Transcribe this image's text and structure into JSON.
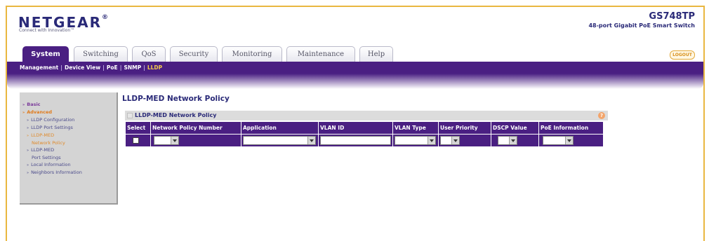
{
  "header": {
    "brand": "NETGEAR",
    "brand_mark": "®",
    "tagline": "Connect with Innovation™",
    "model": "GS748TP",
    "model_desc": "48-port Gigabit PoE Smart Switch"
  },
  "tabs": [
    {
      "label": "System",
      "active": true
    },
    {
      "label": "Switching",
      "active": false
    },
    {
      "label": "QoS",
      "active": false
    },
    {
      "label": "Security",
      "active": false
    },
    {
      "label": "Monitoring",
      "active": false
    },
    {
      "label": "Maintenance",
      "active": false
    },
    {
      "label": "Help",
      "active": false
    }
  ],
  "logout_label": "LOGOUT",
  "subnav": {
    "items": [
      "Management",
      "Device View",
      "PoE",
      "SNMP",
      "LLDP"
    ],
    "separator": "|",
    "current": "LLDP"
  },
  "leftnav": {
    "basic": "Basic",
    "advanced": "Advanced",
    "items": [
      "LLDP Configuration",
      "LLDP Port Settings",
      "LLDP-MED",
      "Network Policy",
      "LLDP-MED",
      "Port Settings",
      "Local Information",
      "Neighbors Information"
    ],
    "arrow": "»",
    "top_arrow": "»"
  },
  "page_title": "LLDP-MED Network Policy",
  "panel": {
    "title": "LLDP-MED Network Policy",
    "help": "?"
  },
  "table": {
    "columns": [
      "Select",
      "Network Policy Number",
      "Application",
      "VLAN ID",
      "VLAN Type",
      "User Priority",
      "DSCP Value",
      "PoE Information"
    ]
  },
  "colors": {
    "brand_purple": "#4a1f82",
    "accent_orange": "#e08a2a",
    "frame_gold": "#e9b740"
  }
}
